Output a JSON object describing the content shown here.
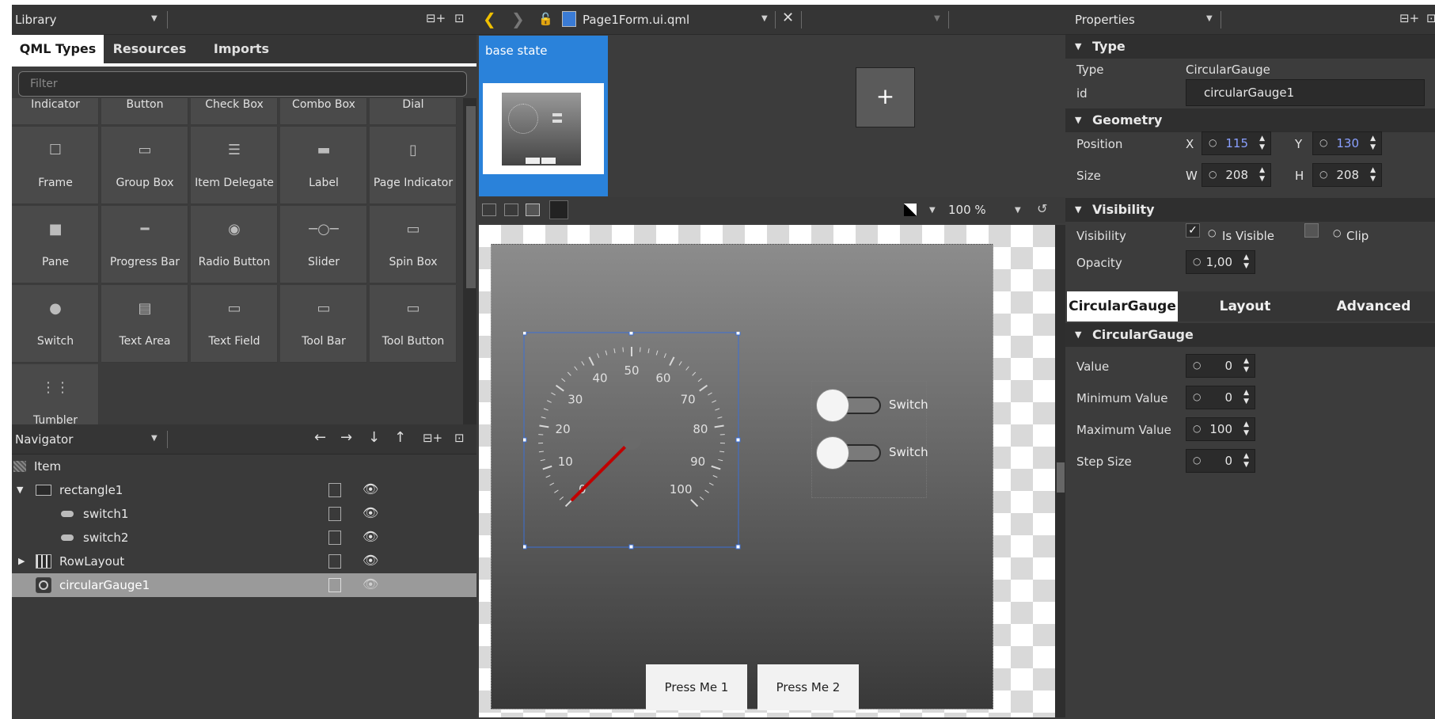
{
  "library": {
    "title": "Library",
    "tabs": [
      "QML Types",
      "Resources",
      "Imports"
    ],
    "filter_placeholder": "Filter",
    "partial_row": [
      "Indicator",
      "Button",
      "Check Box",
      "Combo Box",
      "Dial"
    ],
    "rows": [
      [
        {
          "label": "Frame",
          "icon": "frame-icon"
        },
        {
          "label": "Group Box",
          "icon": "group-box-icon"
        },
        {
          "label": "Item Delegate",
          "icon": "item-delegate-icon"
        },
        {
          "label": "Label",
          "icon": "label-icon"
        },
        {
          "label": "Page Indicator",
          "icon": "page-indicator-icon"
        }
      ],
      [
        {
          "label": "Pane",
          "icon": "pane-icon"
        },
        {
          "label": "Progress Bar",
          "icon": "progress-bar-icon"
        },
        {
          "label": "Radio Button",
          "icon": "radio-button-icon"
        },
        {
          "label": "Slider",
          "icon": "slider-icon"
        },
        {
          "label": "Spin Box",
          "icon": "spin-box-icon"
        }
      ],
      [
        {
          "label": "Switch",
          "icon": "switch-icon"
        },
        {
          "label": "Text Area",
          "icon": "text-area-icon"
        },
        {
          "label": "Text Field",
          "icon": "text-field-icon"
        },
        {
          "label": "Tool Bar",
          "icon": "tool-bar-icon"
        },
        {
          "label": "Tool Button",
          "icon": "tool-button-icon"
        }
      ],
      [
        {
          "label": "Tumbler",
          "icon": "tumbler-icon"
        }
      ]
    ]
  },
  "navigator": {
    "title": "Navigator",
    "items": [
      {
        "label": "Item",
        "icon": "item-icon"
      },
      {
        "label": "rectangle1",
        "icon": "rectangle-icon"
      },
      {
        "label": "switch1",
        "icon": "switch-icon"
      },
      {
        "label": "switch2",
        "icon": "switch-icon"
      },
      {
        "label": "RowLayout",
        "icon": "row-layout-icon"
      },
      {
        "label": "circularGauge1",
        "icon": "circular-gauge-icon"
      }
    ]
  },
  "editor": {
    "file_name": "Page1Form.ui.qml",
    "state_name": "base state",
    "width": "640",
    "height": "480",
    "zoom": "100 %"
  },
  "form": {
    "gauge_labels": [
      "0",
      "10",
      "20",
      "30",
      "40",
      "50",
      "60",
      "70",
      "80",
      "90",
      "100"
    ],
    "gauge_value": 0,
    "switch1_label": "Switch",
    "switch2_label": "Switch",
    "button1": "Press Me 1",
    "button2": "Press Me 2"
  },
  "properties": {
    "title": "Properties",
    "type_section": "Type",
    "type_label": "Type",
    "type_value": "CircularGauge",
    "id_label": "id",
    "id_value": "circularGauge1",
    "geometry_section": "Geometry",
    "position_label": "Position",
    "size_label": "Size",
    "x_label": "X",
    "y_label": "Y",
    "w_label": "W",
    "h_label": "H",
    "x_value": "115",
    "y_value": "130",
    "w_value": "208",
    "h_value": "208",
    "visibility_section": "Visibility",
    "visibility_label": "Visibility",
    "is_visible": "Is Visible",
    "clip": "Clip",
    "opacity_label": "Opacity",
    "opacity_value": "1,00",
    "tabs": [
      "CircularGauge",
      "Layout",
      "Advanced"
    ],
    "gauge_section": "CircularGauge",
    "value_label": "Value",
    "value": "0",
    "min_label": "Minimum Value",
    "min_value": "0",
    "max_label": "Maximum Value",
    "max_value": "100",
    "step_label": "Step Size",
    "step_value": "0"
  },
  "colors": {
    "accent": "#2a82da",
    "needle": "#c00000",
    "selection": "#3b6fd6"
  }
}
